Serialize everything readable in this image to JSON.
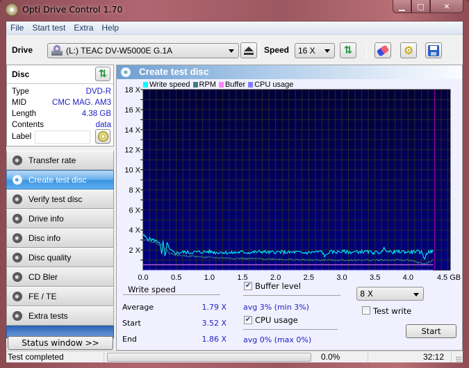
{
  "window": {
    "title": "Opti Drive Control 1.70",
    "controls": {
      "minimize": "▁",
      "maximize": "□",
      "close": "✕"
    }
  },
  "menu": [
    "File",
    "Start test",
    "Extra",
    "Help"
  ],
  "toolbar": {
    "drive_label": "Drive",
    "drive_value": "(L:)   TEAC DV-W5000E G.1A",
    "speed_label": "Speed",
    "speed_value": "16 X",
    "icons": [
      "drive-icon",
      "eject-icon",
      "refresh-icon",
      "erase-icon",
      "settings-icon",
      "save-icon"
    ]
  },
  "disc": {
    "title": "Disc",
    "rows": [
      {
        "label": "Type",
        "value": "DVD-R"
      },
      {
        "label": "MID",
        "value": "CMC MAG. AM3"
      },
      {
        "label": "Length",
        "value": "4.38 GB"
      },
      {
        "label": "Contents",
        "value": "data"
      }
    ],
    "label_field_label": "Label",
    "label_field_value": ""
  },
  "nav": {
    "items": [
      {
        "label": "Transfer rate",
        "active": false
      },
      {
        "label": "Create test disc",
        "active": true
      },
      {
        "label": "Verify test disc",
        "active": false
      },
      {
        "label": "Drive info",
        "active": false
      },
      {
        "label": "Disc info",
        "active": false
      },
      {
        "label": "Disc quality",
        "active": false
      },
      {
        "label": "CD Bler",
        "active": false
      },
      {
        "label": "FE / TE",
        "active": false
      },
      {
        "label": "Extra tests",
        "active": false
      }
    ],
    "status_window_button": "Status window >>"
  },
  "main": {
    "title": "Create test disc",
    "legend": [
      {
        "label": "Write speed",
        "color": "#00ffff"
      },
      {
        "label": "RPM",
        "color": "#3a8080"
      },
      {
        "label": "Buffer",
        "color": "#ff80ff"
      },
      {
        "label": "CPU usage",
        "color": "#8080ff"
      }
    ]
  },
  "chart_data": {
    "type": "line",
    "title": "Create test disc",
    "xlabel": "GB",
    "ylabel": "X",
    "xlim": [
      0,
      4.6
    ],
    "ylim": [
      0,
      18
    ],
    "x_ticks": [
      0.0,
      0.5,
      1.0,
      1.5,
      2.0,
      2.5,
      3.0,
      3.5,
      4.0,
      4.5
    ],
    "x_tick_labels": [
      "0.0",
      "0.5",
      "1.0",
      "1.5",
      "2.0",
      "2.5",
      "3.0",
      "3.5",
      "4.0",
      "4.5 GB"
    ],
    "y_ticks": [
      2,
      4,
      6,
      8,
      10,
      12,
      14,
      16,
      18
    ],
    "y_tick_labels": [
      "2 X",
      "4 X",
      "6 X",
      "8 X",
      "10 X",
      "12 X",
      "14 X",
      "16 X",
      "18 X"
    ],
    "grid": true,
    "disc_end_marker_gb": 4.38,
    "series": [
      {
        "name": "Write speed",
        "color": "#00ffff",
        "x": [
          0.0,
          0.05,
          0.1,
          0.15,
          0.2,
          0.25,
          0.28,
          0.3,
          0.33,
          0.36,
          0.4,
          0.45,
          0.5,
          0.6,
          0.7,
          0.8,
          0.9,
          1.0,
          1.1,
          1.2,
          1.3,
          1.4,
          1.5,
          1.6,
          1.7,
          1.8,
          1.9,
          2.0,
          2.1,
          2.2,
          2.3,
          2.4,
          2.5,
          2.6,
          2.7,
          2.75,
          2.8,
          2.9,
          3.0,
          3.1,
          3.2,
          3.3,
          3.4,
          3.5,
          3.6,
          3.65,
          3.7,
          3.8,
          3.9,
          4.0,
          4.1,
          4.2,
          4.25,
          4.3,
          4.38
        ],
        "y": [
          3.5,
          3.2,
          3.1,
          3.0,
          2.9,
          2.8,
          1.5,
          2.8,
          1.3,
          2.7,
          2.0,
          1.8,
          1.7,
          1.8,
          1.75,
          1.8,
          1.8,
          1.85,
          1.75,
          1.8,
          1.7,
          1.75,
          1.8,
          1.75,
          1.8,
          1.85,
          1.75,
          1.8,
          1.8,
          1.75,
          1.8,
          1.7,
          1.75,
          1.8,
          1.85,
          1.3,
          1.8,
          1.8,
          1.85,
          1.8,
          1.8,
          1.85,
          1.8,
          1.75,
          1.8,
          2.2,
          1.8,
          1.8,
          1.85,
          1.8,
          1.85,
          1.8,
          1.2,
          1.85,
          1.86
        ]
      },
      {
        "name": "RPM",
        "color": "#3a8080",
        "x": [
          0.0,
          0.1,
          0.2,
          0.3,
          0.4,
          0.5,
          0.7,
          1.0,
          1.5,
          2.0,
          2.5,
          3.0,
          3.5,
          4.0,
          4.25,
          4.38
        ],
        "y": [
          3.1,
          2.9,
          2.7,
          2.4,
          1.7,
          1.5,
          1.4,
          1.25,
          1.15,
          1.1,
          1.0,
          1.0,
          1.0,
          1.0,
          0.6,
          1.0
        ]
      },
      {
        "name": "Buffer",
        "color": "#ff80ff",
        "x": [
          0.0,
          4.38
        ],
        "y": [
          0.54,
          0.54
        ]
      },
      {
        "name": "CPU usage",
        "color": "#8080ff",
        "x": [
          0.0,
          4.38
        ],
        "y": [
          0.0,
          0.0
        ]
      }
    ]
  },
  "stats": {
    "title": "Write speed",
    "rows": [
      {
        "label": "Average",
        "value": "1.79 X"
      },
      {
        "label": "Start",
        "value": "3.52 X"
      },
      {
        "label": "End",
        "value": "1.86 X"
      }
    ],
    "buffer_level": {
      "label": "Buffer level",
      "checked": true,
      "summary": "avg 3% (min 3%)"
    },
    "cpu_usage": {
      "label": "CPU usage",
      "checked": true,
      "summary": "avg 0% (max 0%)"
    },
    "write_speed_select": "8 X",
    "test_write": {
      "label": "Test write",
      "checked": false
    },
    "start_button": "Start"
  },
  "statusbar": {
    "text": "Test completed",
    "progress_percent": 0.0,
    "progress_label": "0.0%",
    "elapsed": "32:12"
  }
}
